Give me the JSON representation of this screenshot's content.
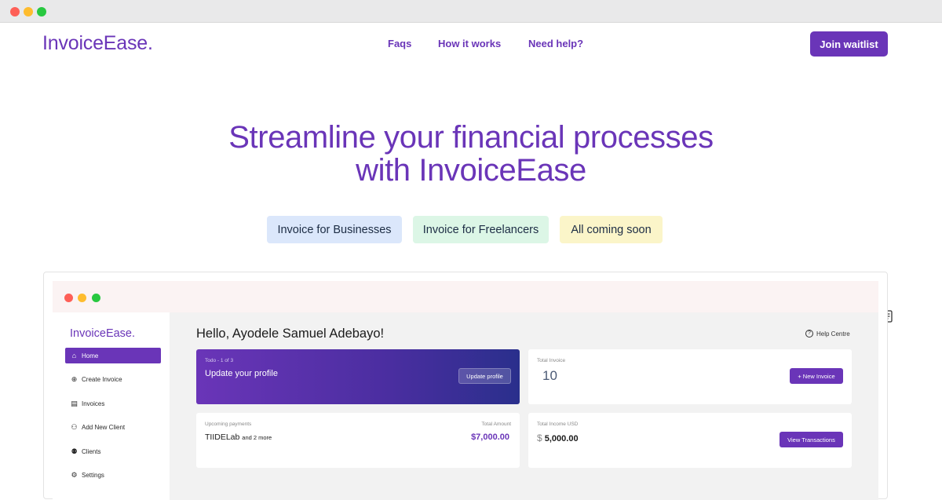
{
  "browser": {
    "dots": [
      "#fe5f57",
      "#febc2e",
      "#28c840"
    ]
  },
  "header": {
    "brand": "InvoiceEase.",
    "nav": [
      "Faqs",
      "How it works",
      "Need help?"
    ],
    "cta": "Join waitlist"
  },
  "hero": {
    "line1": "Streamline your financial processes",
    "line2": "with InvoiceEase"
  },
  "pills": [
    {
      "label": "Invoice for Businesses",
      "bg": "#dbe7fb"
    },
    {
      "label": "Invoice for Freelancers",
      "bg": "#dcf6e6"
    },
    {
      "label": "All coming soon",
      "bg": "#fbf5c9"
    }
  ],
  "mock": {
    "brand": "InvoiceEase.",
    "sidebar": [
      {
        "icon": "home-icon",
        "glyph": "⌂",
        "label": "Home",
        "active": true
      },
      {
        "icon": "plus-circle-icon",
        "glyph": "⊕",
        "label": "Create Invoice",
        "active": false
      },
      {
        "icon": "invoice-icon",
        "glyph": "▤",
        "label": "Invoices",
        "active": false
      },
      {
        "icon": "add-user-icon",
        "glyph": "⚇",
        "label": "Add New Client",
        "active": false
      },
      {
        "icon": "clients-icon",
        "glyph": "⚉",
        "label": "Clients",
        "active": false
      },
      {
        "icon": "settings-icon",
        "glyph": "⚙",
        "label": "Settings",
        "active": false
      }
    ],
    "greeting": "Hello, Ayodele Samuel Adebayo!",
    "help": "Help Centre",
    "todo": {
      "label": "Todo - 1 of 3",
      "title": "Update your profile",
      "button": "Update profile"
    },
    "total_invoice": {
      "label": "Total Invoice",
      "value": "10",
      "button": "+ New Invoice"
    },
    "upcoming": {
      "label": "Upcoming payments",
      "amount_label": "Total Amount",
      "client": "TIIDELab",
      "more": "and 2 more",
      "amount": "$7,000.00"
    },
    "income": {
      "label": "Total Income USD",
      "currency": "$",
      "value": "5,000.00",
      "button": "View Transactions"
    }
  }
}
